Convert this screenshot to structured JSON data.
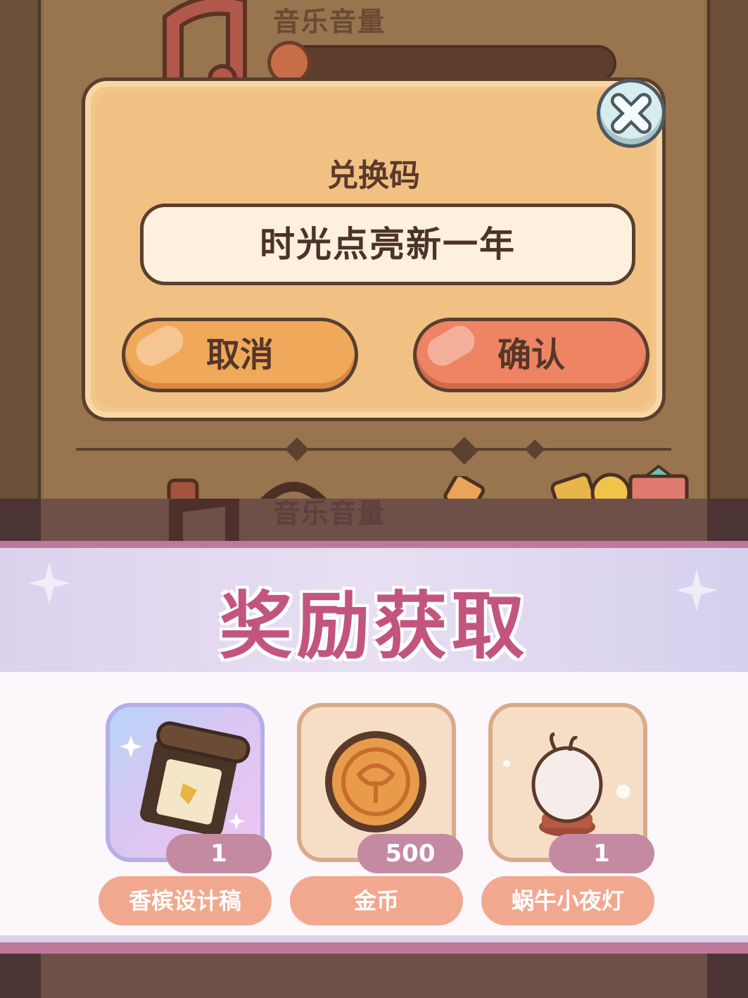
{
  "settings": {
    "music_volume_label": "音乐音量"
  },
  "redeem_dialog": {
    "title": "兑换码",
    "code_value": "时光点亮新一年",
    "cancel_label": "取消",
    "confirm_label": "确认"
  },
  "reward_popup": {
    "title": "奖励获取",
    "items": [
      {
        "name": "香槟设计稿",
        "count": "1",
        "icon": "design-scroll-icon"
      },
      {
        "name": "金币",
        "count": "500",
        "icon": "gold-coin-icon"
      },
      {
        "name": "蜗牛小夜灯",
        "count": "1",
        "icon": "snail-night-lamp-icon"
      }
    ]
  },
  "colors": {
    "dialog_bg": "#f3c68b",
    "confirm": "#ee8464",
    "cancel": "#f0a85a",
    "reward_title": "#c2557e",
    "count_badge": "#c48aa2",
    "name_pill": "#f2a88f"
  }
}
